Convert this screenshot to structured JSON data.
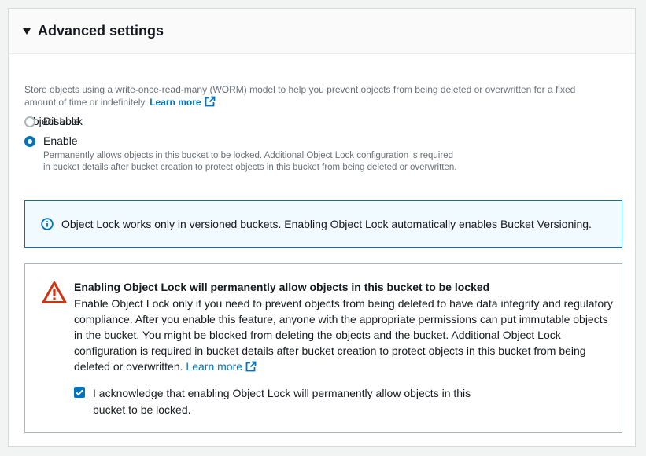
{
  "header": {
    "title": "Advanced settings",
    "caret_icon": "caret-down-icon"
  },
  "object_lock": {
    "label": "Object Lock",
    "description": "Store objects using a write-once-read-many (WORM) model to help you prevent objects from being deleted or overwritten for a fixed amount of time or indefinitely.",
    "learn_more": "Learn more",
    "options": [
      {
        "label": "Disable",
        "checked": false
      },
      {
        "label": "Enable",
        "checked": true,
        "description": "Permanently allows objects in this bucket to be locked. Additional Object Lock configuration is required in bucket details after bucket creation to protect objects in this bucket from being deleted or overwritten."
      }
    ]
  },
  "info": {
    "icon": "info-icon",
    "text": "Object Lock works only in versioned buckets. Enabling Object Lock automatically enables Bucket Versioning."
  },
  "warning": {
    "icon": "warning-icon",
    "title": "Enabling Object Lock will permanently allow objects in this bucket to be locked",
    "text": "Enable Object Lock only if you need to prevent objects from being deleted to have data integrity and regulatory compliance. After you enable this feature, anyone with the appropriate permissions can put immutable objects in the bucket. You might be blocked from deleting the objects and the bucket. Additional Object Lock configuration is required in bucket details after bucket creation to protect objects in this bucket from being deleted or overwritten.",
    "learn_more": "Learn more",
    "acknowledge": {
      "checked": true,
      "label": "I acknowledge that enabling Object Lock will permanently allow objects in this bucket to be locked."
    }
  },
  "colors": {
    "accent": "#0073bb",
    "warning": "#d13212",
    "info_bg": "#f1faff"
  }
}
